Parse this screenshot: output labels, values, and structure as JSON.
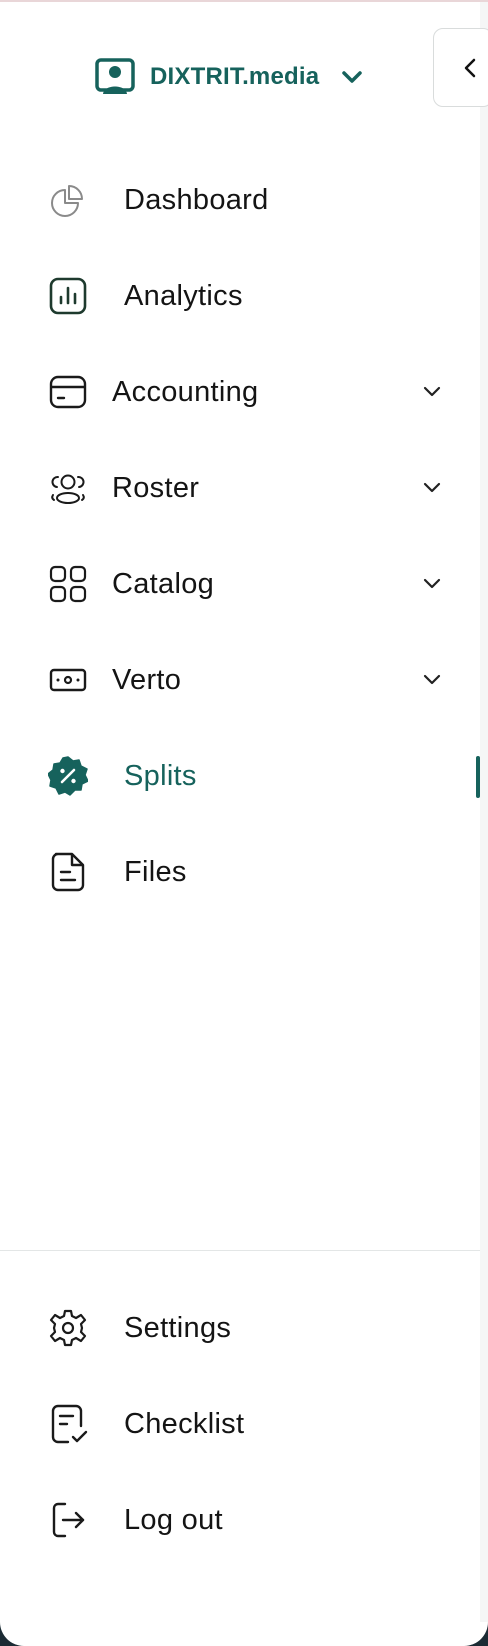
{
  "org": {
    "name": "DIXTRIT.media",
    "avatar_icon": "user-id-card-icon",
    "chevron_icon": "chevron-down-icon"
  },
  "collapse": {
    "icon": "chevron-left-icon"
  },
  "colors": {
    "accent": "#16625c",
    "text": "#141414",
    "muted": "#8a8a8a"
  },
  "nav": {
    "items": [
      {
        "id": "dashboard",
        "label": "Dashboard",
        "icon": "pie-chart-icon",
        "has_submenu": false
      },
      {
        "id": "analytics",
        "label": "Analytics",
        "icon": "bar-chart-icon",
        "has_submenu": false
      },
      {
        "id": "accounting",
        "label": "Accounting",
        "icon": "credit-card-icon",
        "has_submenu": true
      },
      {
        "id": "roster",
        "label": "Roster",
        "icon": "users-icon",
        "has_submenu": true
      },
      {
        "id": "catalog",
        "label": "Catalog",
        "icon": "grid-icon",
        "has_submenu": true
      },
      {
        "id": "verto",
        "label": "Verto",
        "icon": "banknote-icon",
        "has_submenu": true
      },
      {
        "id": "splits",
        "label": "Splits",
        "icon": "percent-badge-icon",
        "has_submenu": false,
        "active": true
      },
      {
        "id": "files",
        "label": "Files",
        "icon": "file-text-icon",
        "has_submenu": false
      }
    ]
  },
  "footer_nav": {
    "items": [
      {
        "id": "settings",
        "label": "Settings",
        "icon": "gear-icon"
      },
      {
        "id": "checklist",
        "label": "Checklist",
        "icon": "checklist-icon"
      },
      {
        "id": "logout",
        "label": "Log out",
        "icon": "logout-icon"
      }
    ]
  }
}
